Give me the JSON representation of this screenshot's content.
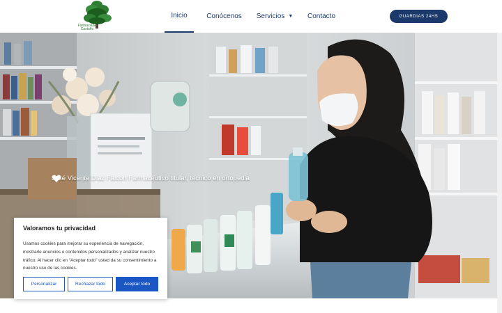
{
  "header": {
    "logo_text": "Farmacia El Castaño",
    "nav": [
      {
        "label": "Inicio",
        "active": true
      },
      {
        "label": "Conócenos",
        "active": false
      },
      {
        "label": "Servicios",
        "active": false,
        "dropdown": true
      },
      {
        "label": "Contacto",
        "active": false
      }
    ],
    "cta_label": "GUARDIAS 24HS"
  },
  "hero": {
    "caption": "José Vicente Díaz Falcón Farmacéutico titular, técnico en ortopedia",
    "caption_icon": "heart-icon",
    "image": "pharmacist-woman-mask-holding-bottle"
  },
  "cookie_banner": {
    "title": "Valoramos tu privacidad",
    "body": "Usamos cookies para mejorar su experiencia de navegación, mostrarle anuncios o contenidos personalizados y analizar nuestro tráfico. Al hacer clic en \"Aceptar todo\" usted da su consentimiento a nuestro uso de las cookies.",
    "buttons": {
      "customize": "Personalizar",
      "reject": "Rechazar todo",
      "accept": "Aceptar todo"
    }
  },
  "colors": {
    "brand_navy": "#1b3a6b",
    "cookie_blue": "#1a56c4",
    "logo_green": "#2e7d32"
  }
}
